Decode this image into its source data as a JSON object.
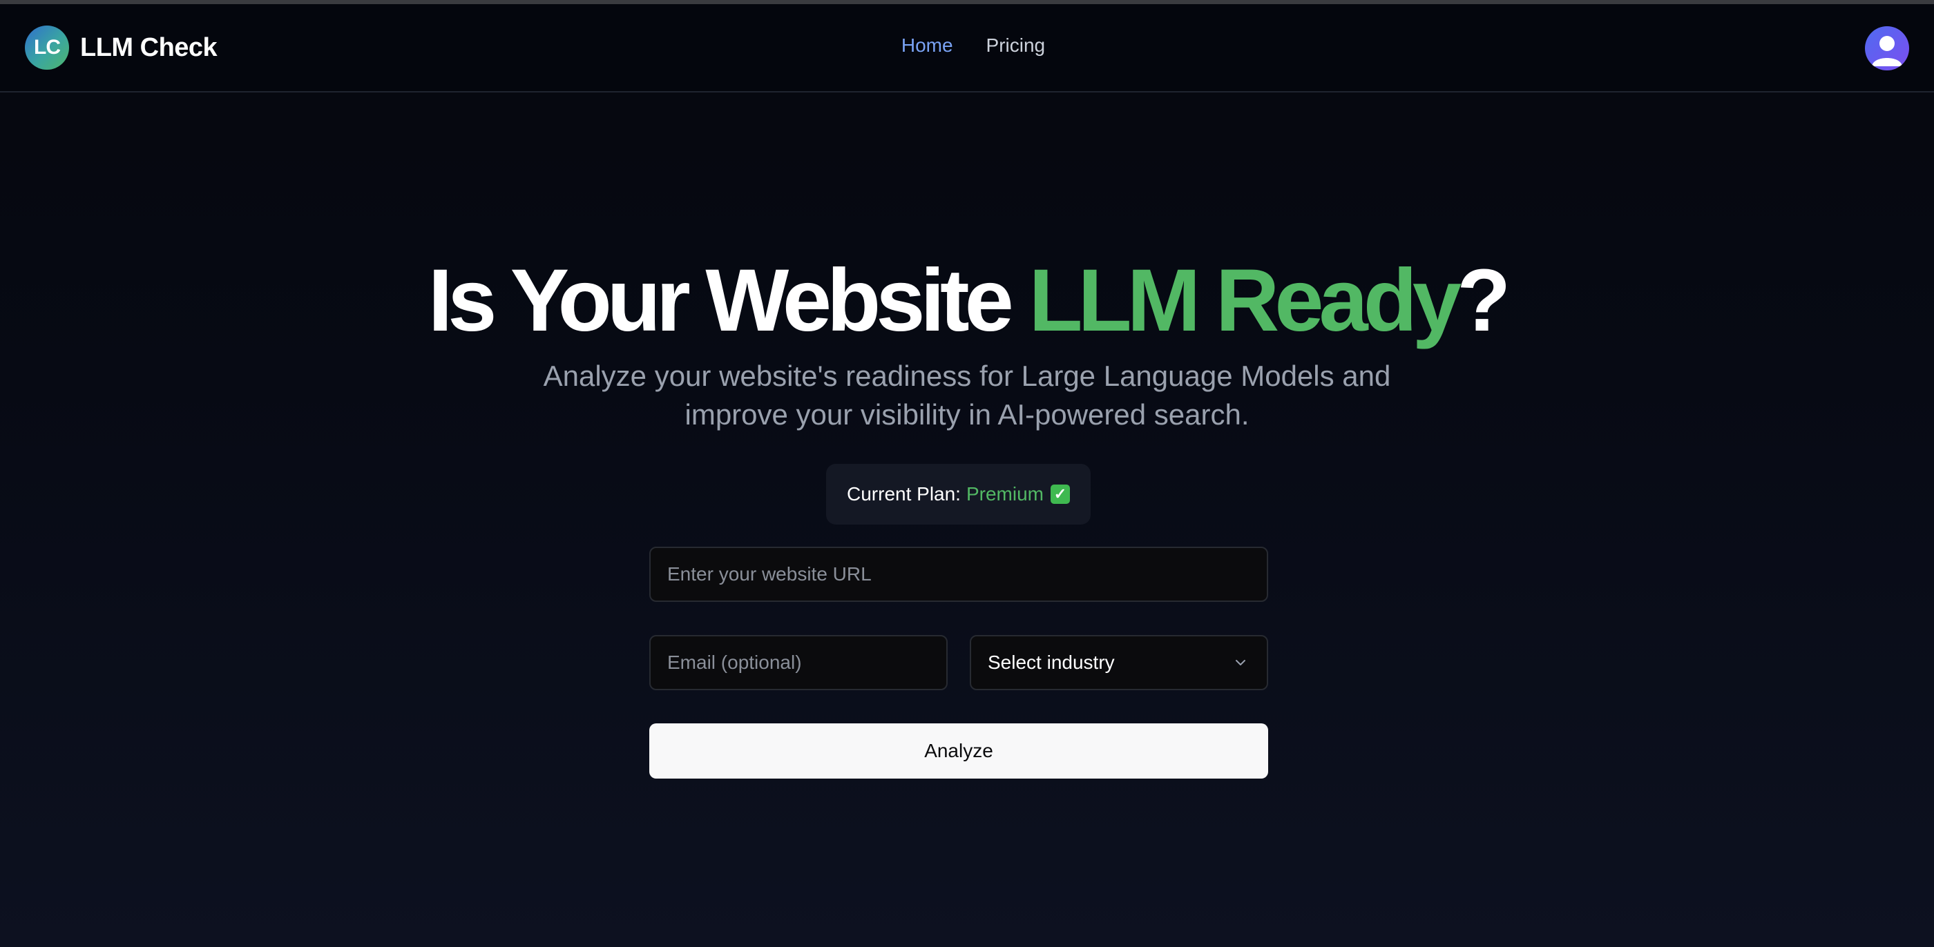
{
  "header": {
    "logo_initials": "LC",
    "app_name": "LLM Check",
    "nav": [
      {
        "label": "Home",
        "active": true
      },
      {
        "label": "Pricing",
        "active": false
      }
    ],
    "avatar_icon": "user-icon"
  },
  "hero": {
    "title_prefix": "Is Your Website ",
    "title_accent": "LLM Ready",
    "title_suffix": "?",
    "subtitle": "Analyze your website's readiness for Large Language Models and improve your visibility in AI-powered search."
  },
  "plan": {
    "label": "Current Plan:",
    "value": "Premium",
    "badge": "✓",
    "badge_icon": "check-square-icon"
  },
  "form": {
    "url_placeholder": "Enter your website URL",
    "url_value": "",
    "email_placeholder": "Email (optional)",
    "email_value": "",
    "industry_selected": "Select industry",
    "industry_icon": "chevron-down-icon",
    "analyze_label": "Analyze"
  },
  "colors": {
    "accent_green": "#52b864",
    "nav_active": "#7aa3f5",
    "background": "#06080f"
  }
}
